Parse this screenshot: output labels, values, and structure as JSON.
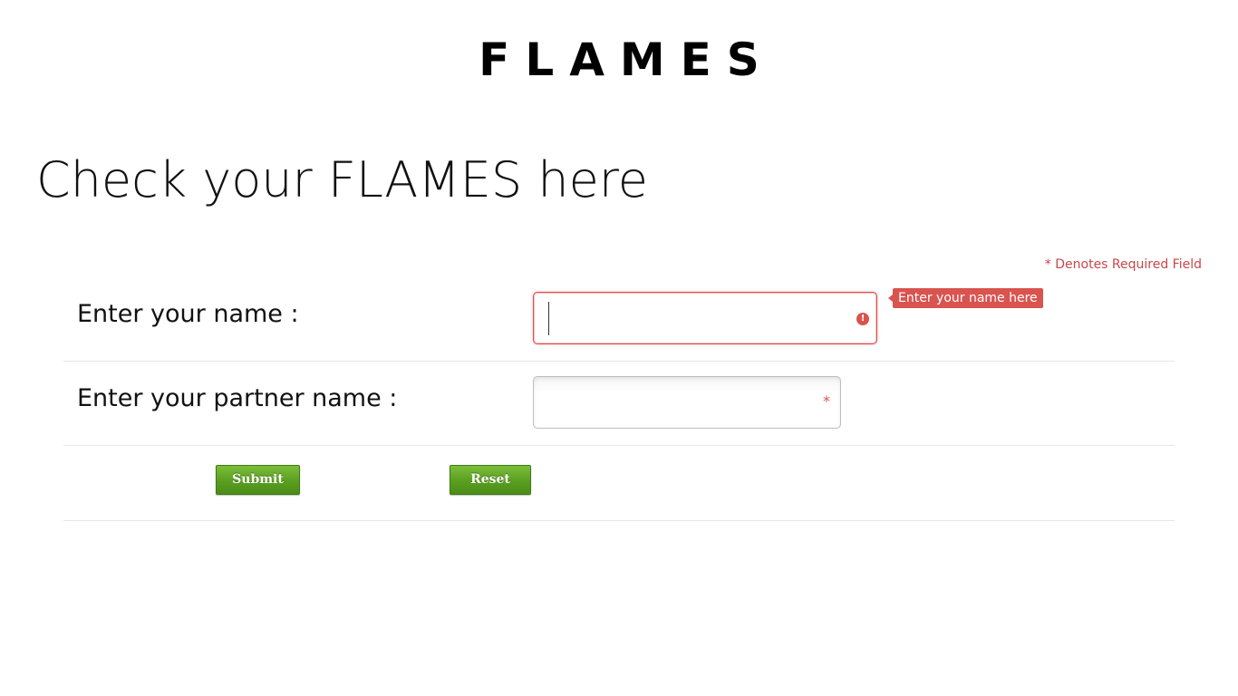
{
  "app": {
    "title": "FLAMES"
  },
  "page": {
    "heading": "Check your FLAMES here",
    "required_note": "* Denotes Required Field"
  },
  "form": {
    "name_field": {
      "label": "Enter your name :",
      "value": "",
      "tooltip": "Enter your name here",
      "state": "error",
      "error_icon": "!"
    },
    "partner_field": {
      "label": "Enter your partner name :",
      "value": "",
      "required_marker": "*"
    },
    "buttons": {
      "submit_label": "Submit",
      "reset_label": "Reset"
    }
  },
  "colors": {
    "error": "#d9534f",
    "button_green": "#5a9e21",
    "required_text": "#c9474a"
  }
}
